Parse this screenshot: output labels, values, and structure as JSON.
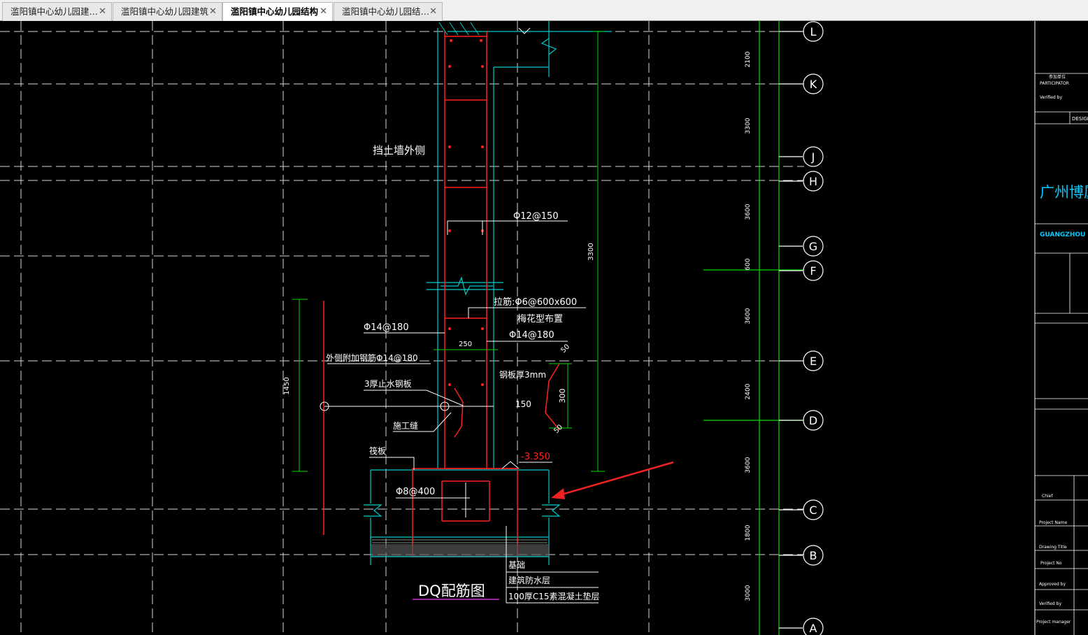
{
  "tabs": [
    {
      "label": "滥阳镇中心幼儿园建…",
      "close": "✕",
      "active": false
    },
    {
      "label": "滥阳镇中心幼儿园建筑",
      "close": "✕",
      "active": false
    },
    {
      "label": "滥阳镇中心幼儿园结构",
      "close": "✕",
      "active": true
    },
    {
      "label": "滥阳镇中心幼儿园结…",
      "close": "✕",
      "active": false
    }
  ],
  "drawing": {
    "title": "DQ配筋图",
    "wall_outside_label": "挡土墙外侧",
    "rebar_vertical": "Φ12@150",
    "tie_bar": "拉筋:Φ6@600x600",
    "tie_bar_layout": "梅花型布置",
    "rebar_left": "Φ14@180",
    "rebar_right": "Φ14@180",
    "extra_rebar": "外侧附加钢筋Φ14@180",
    "waterstop": "3厚止水钢板",
    "construction_joint": "施工缝",
    "raft": "筏板",
    "raft_rebar": "Φ8@400",
    "steel_plate": "钢板厚3mm",
    "wall_thickness": "250",
    "dim_150": "150",
    "dim_300": "300",
    "dim_50a": "50",
    "dim_50b": "50",
    "dim_1450": "1450",
    "dim_3300": "3300",
    "elevation": "-3.350",
    "layer1": "基础",
    "layer2": "建筑防水层",
    "layer3": "100厚C15素混凝土垫层"
  },
  "grid": {
    "axes": [
      "L",
      "K",
      "J",
      "H",
      "G",
      "F",
      "E",
      "D",
      "C",
      "B",
      "A"
    ],
    "spacings": [
      "2100",
      "3300",
      "3600",
      "600",
      "3600",
      "2400",
      "3600",
      "1800",
      "3000"
    ]
  },
  "title_block": {
    "participator": "参加单位",
    "participator_en": "PARTICIPATOR",
    "verified_by_top": "Verified by",
    "design": "DESIGN",
    "company": "广州博厦",
    "company_en": "GUANGZHOU BOSH",
    "chief": "Chief",
    "project_name": "Project Name",
    "drawing_title": "Drawing Title",
    "project_no": "Project No",
    "approved_by": "Approved by",
    "verified_by": "Verified by",
    "project_manager": "Project manager"
  },
  "colors": {
    "wall": "#ff2020",
    "leader": "#ffffff",
    "dim": "#00dd00",
    "axis": "#ffffff",
    "cyan": "#00cccc",
    "arrow": "#ee2222",
    "title_underline": "#cc33cc"
  }
}
